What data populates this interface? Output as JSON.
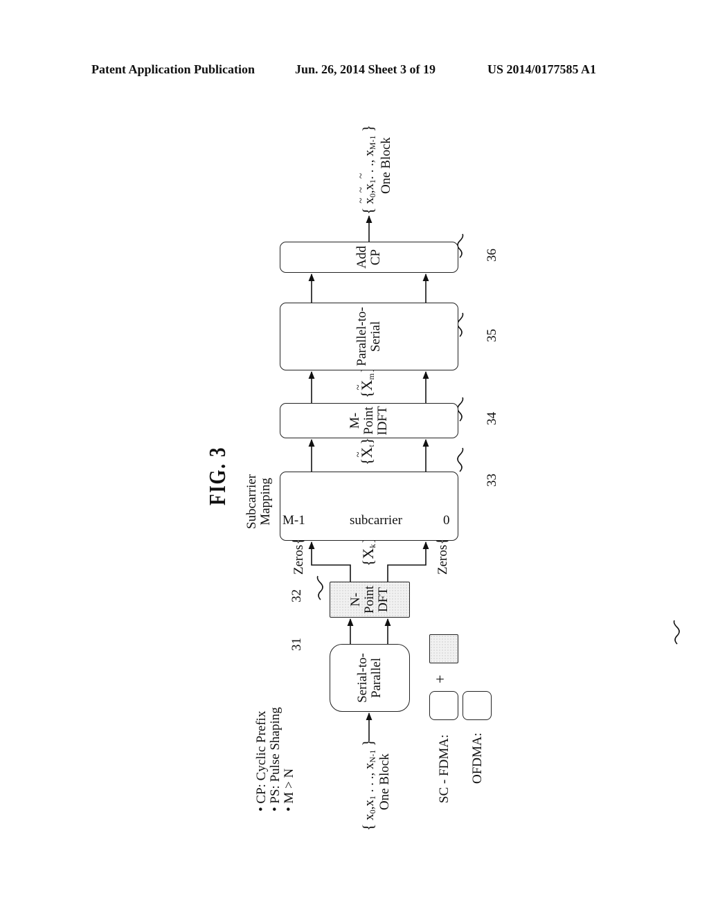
{
  "header": {
    "publication": "Patent Application Publication",
    "date_sheet": "Jun. 26, 2014  Sheet 3 of 19",
    "patent_number": "US 2014/0177585 A1"
  },
  "figure": {
    "title": "FIG.  3",
    "notes": [
      "• CP: Cyclic Prefix",
      "• PS: Pulse Shaping",
      "• M > N"
    ],
    "input": {
      "symbols": [
        "x",
        "0",
        ",x",
        "1",
        " . . ., x",
        "N-1"
      ],
      "caption": "One Block"
    },
    "output": {
      "symbols": [
        "x",
        "0",
        ",x",
        "1",
        " . . ., x",
        "M-1"
      ],
      "caption": "One Block"
    },
    "blocks": [
      {
        "id": "31",
        "line1": "Serial-to-",
        "line2": "Parallel",
        "line3": ""
      },
      {
        "id": "32",
        "line1": "N-",
        "line2": "Point",
        "line3": "DFT"
      },
      {
        "id": "33",
        "line1": "",
        "line2": "",
        "line3": ""
      },
      {
        "id": "34",
        "line1": "M-",
        "line2": "Point",
        "line3": "IDFT"
      },
      {
        "id": "35",
        "line1": "Parallel-to-",
        "line2": "Serial",
        "line3": ""
      },
      {
        "id": "36",
        "line1": "Add",
        "line2": "CP",
        "line3": ""
      }
    ],
    "subcarrier_mapping": {
      "caption_line1": "Subcarrier",
      "caption_line2": "Mapping",
      "axis_label": "subcarrier",
      "start": "0",
      "end": "M-1"
    },
    "signals": {
      "xk": {
        "base": "X",
        "sub": "k"
      },
      "xt": {
        "base": "X",
        "sub": "t"
      },
      "xm": {
        "base": "X",
        "sub": "m"
      },
      "zeros": "Zeros"
    },
    "legend": {
      "scfdma_label": "SC - FDMA:",
      "ofdma_label": "OFDMA:",
      "plus": "+"
    }
  }
}
